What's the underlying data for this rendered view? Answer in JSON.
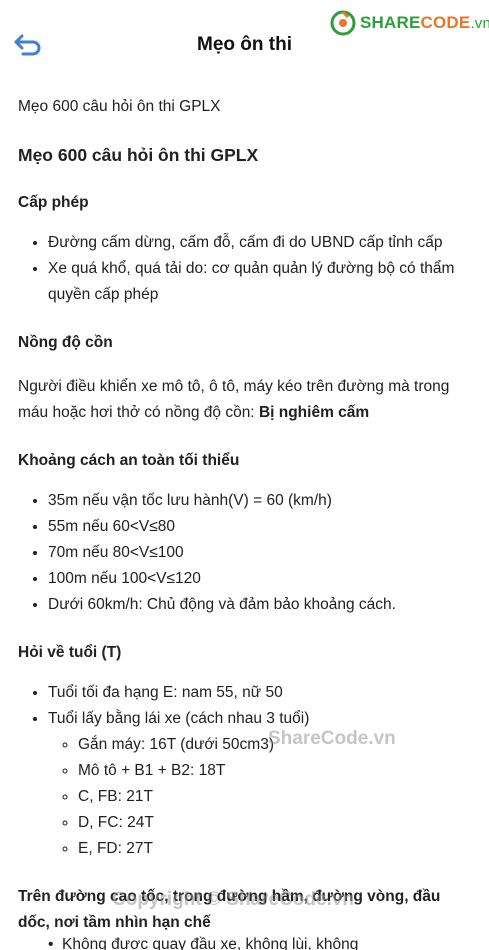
{
  "header": {
    "title": "Mẹo ôn thi",
    "brand_part1": "SHARE",
    "brand_part2": "CODE",
    "brand_part3": ".vn"
  },
  "content": {
    "intro": "Mẹo 600 câu hỏi ôn thi GPLX",
    "main_heading": "Mẹo 600 câu hỏi ôn thi GPLX",
    "sections": {
      "cap_phep": {
        "heading": "Cấp phép",
        "items": [
          "Đường cấm dừng, cấm đỗ, cấm đi do UBND cấp tỉnh cấp",
          "Xe quá khổ, quá tải do: cơ quản quản lý đường bộ có thẩm quyền cấp phép"
        ]
      },
      "nong_do_con": {
        "heading": "Nồng độ cồn",
        "text": "Người điều khiển xe mô tô, ô tô, máy kéo trên đường mà trong máu hoặc hơi thở có nồng độ cồn: ",
        "bold": "Bị nghiêm cấm"
      },
      "khoang_cach": {
        "heading": "Khoảng cách an toàn tối thiểu",
        "items": [
          "35m nếu vận tốc lưu hành(V) = 60 (km/h)",
          "55m nếu 60<V≤80",
          "70m nếu 80<V≤100",
          "100m nếu 100<V≤120",
          "Dưới 60km/h: Chủ động và đảm bảo khoảng cách."
        ]
      },
      "tuoi": {
        "heading": "Hỏi về tuổi (T)",
        "item1": "Tuổi tối đa hạng E: nam 55, nữ 50",
        "item2": "Tuổi lấy bằng lái xe (cách nhau 3 tuổi)",
        "sub_items": [
          "Gắn máy: 16T (dưới 50cm3)",
          "Mô tô + B1 + B2: 18T",
          "C, FB: 21T",
          "D, FC: 24T",
          "E, FD: 27T"
        ]
      },
      "cao_toc": {
        "heading": "Trên đường cao tốc, trong đường hầm, đường vòng, đầu dốc, nơi tầm nhìn hạn chế",
        "partial_item": "Không được quay đầu xe, không lùi, không vượt"
      }
    }
  },
  "watermarks": {
    "mid": "ShareCode.vn",
    "bottom": "Copyright © ShareCode.vn"
  },
  "colors": {
    "brand_green": "#2e9e3c",
    "brand_orange": "#e9762b",
    "back_icon_blue": "#3f7fd6"
  }
}
